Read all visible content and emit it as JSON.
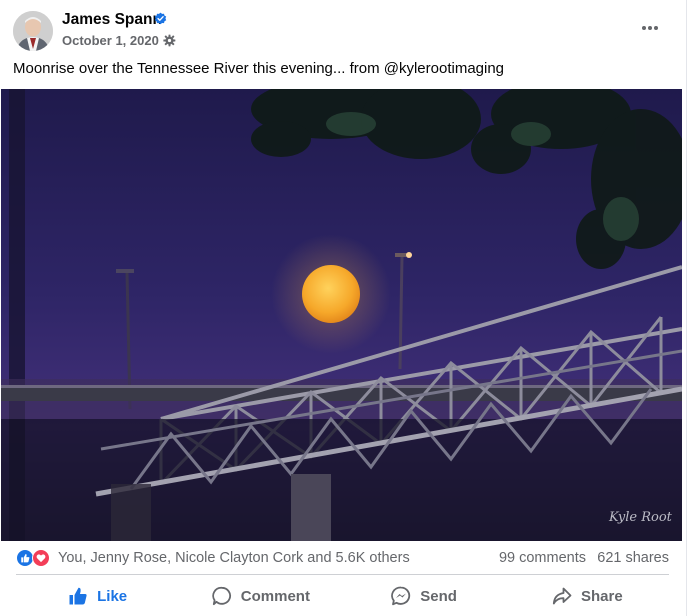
{
  "post": {
    "author": "James Spann",
    "date": "October 1, 2020 ·",
    "text": "Moonrise over the Tennessee River this evening... from @kylerootimaging"
  },
  "photo": {
    "watermark": "Kyle Root"
  },
  "reactions": {
    "summary": "You, Jenny Rose, Nicole Clayton Cork and 5.6K others",
    "comments": "99 comments",
    "shares": "621 shares"
  },
  "actions": {
    "like": "Like",
    "comment": "Comment",
    "send": "Send",
    "share": "Share"
  },
  "colors": {
    "accent": "#1b74e4",
    "love": "#f33e58",
    "secondary_text": "#65676b"
  },
  "icons": {
    "verified": "verified-badge-icon",
    "audience": "gear-icon",
    "more": "more-dots-icon",
    "like": "thumbs-up-icon",
    "comment": "speech-bubble-icon",
    "send": "messenger-icon",
    "share": "share-arrow-icon"
  }
}
